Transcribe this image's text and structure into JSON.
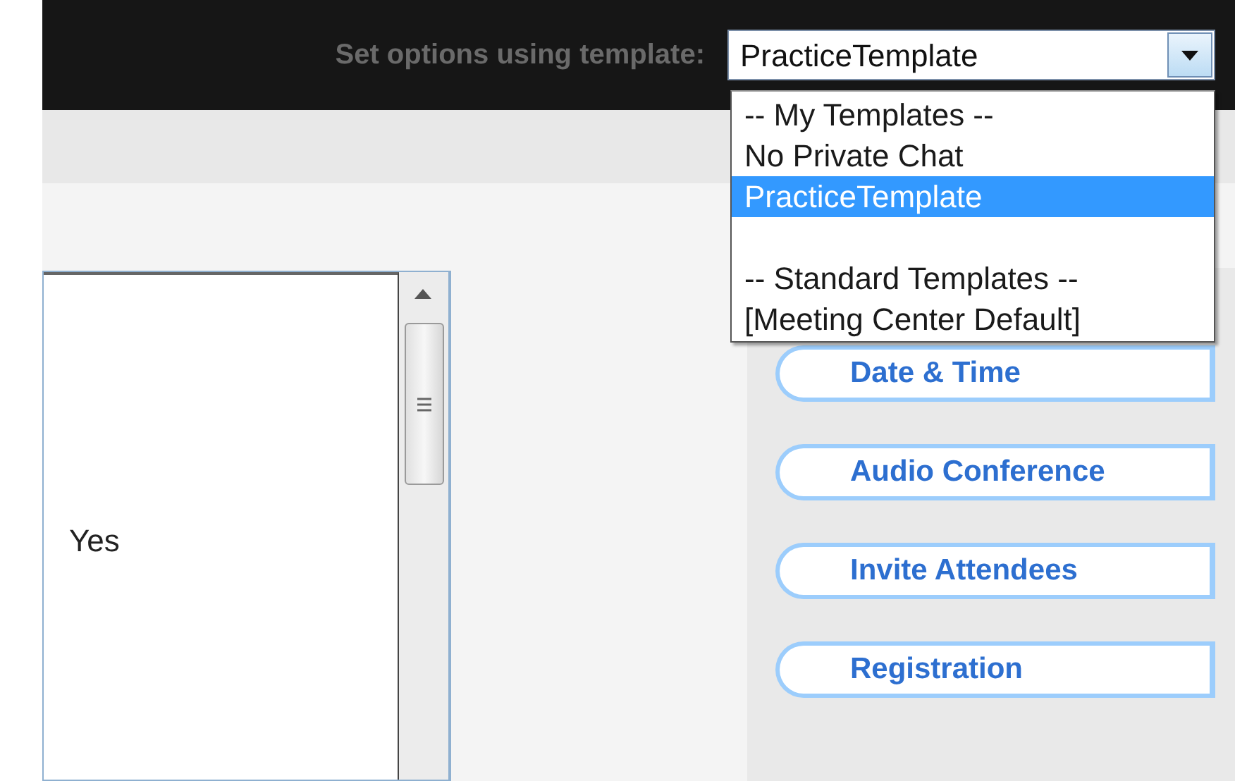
{
  "header": {
    "label": "Set options using template:",
    "template_select": {
      "value": "PracticeTemplate"
    }
  },
  "template_dropdown": {
    "groups": [
      {
        "header": "-- My Templates --",
        "options": [
          {
            "label": "No Private Chat",
            "selected": false
          },
          {
            "label": "PracticeTemplate",
            "selected": true
          }
        ]
      },
      {
        "header": "-- Standard Templates --",
        "options": [
          {
            "label": "[Meeting Center Default]",
            "selected": false
          }
        ]
      }
    ]
  },
  "list_box": {
    "items": [
      "Yes"
    ]
  },
  "side_tabs": [
    {
      "label": "Date & Time"
    },
    {
      "label": "Audio Conference"
    },
    {
      "label": "Invite Attendees"
    },
    {
      "label": "Registration"
    }
  ]
}
